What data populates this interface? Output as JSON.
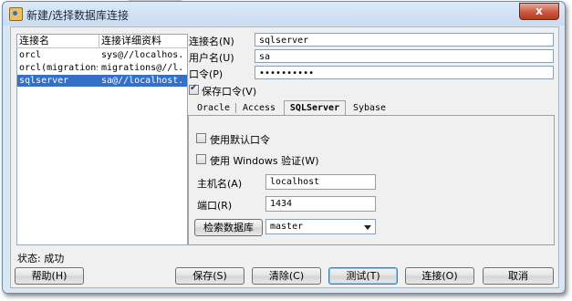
{
  "window": {
    "title": "新建/选择数据库连接",
    "close_label": "x"
  },
  "connections": {
    "columns": [
      "连接名",
      "连接详细资料"
    ],
    "rows": [
      {
        "name": "orcl",
        "details": "sys@//localhos...",
        "selected": false
      },
      {
        "name": "orcl(migrations)",
        "details": "migrations@//l...",
        "selected": false
      },
      {
        "name": "sqlserver",
        "details": "sa@//localhost...",
        "selected": true
      }
    ]
  },
  "status": {
    "label": "状态:",
    "value": "成功"
  },
  "form": {
    "conn_name_label": "连接名(N)",
    "conn_name_value": "sqlserver",
    "user_label": "用户名(U)",
    "user_value": "sa",
    "password_label": "口令(P)",
    "password_value": "••••••••••",
    "save_password_label": "保存口令(V)",
    "save_password_checked": true
  },
  "tabs": [
    {
      "label": "Oracle",
      "active": false
    },
    {
      "label": "Access",
      "active": false
    },
    {
      "label": "SQLServer",
      "active": true
    },
    {
      "label": "Sybase",
      "active": false
    }
  ],
  "sqlserver": {
    "default_password_label": "使用默认口令",
    "windows_auth_label": "使用 Windows 验证(W)",
    "host_label": "主机名(A)",
    "host_value": "localhost",
    "port_label": "端口(R)",
    "port_value": "1434",
    "retrieve_button": "检索数据库",
    "database_value": "master"
  },
  "buttons": {
    "help": "帮助(H)",
    "save": "保存(S)",
    "clear": "清除(C)",
    "test": "测试(T)",
    "connect": "连接(O)",
    "cancel": "取消"
  }
}
